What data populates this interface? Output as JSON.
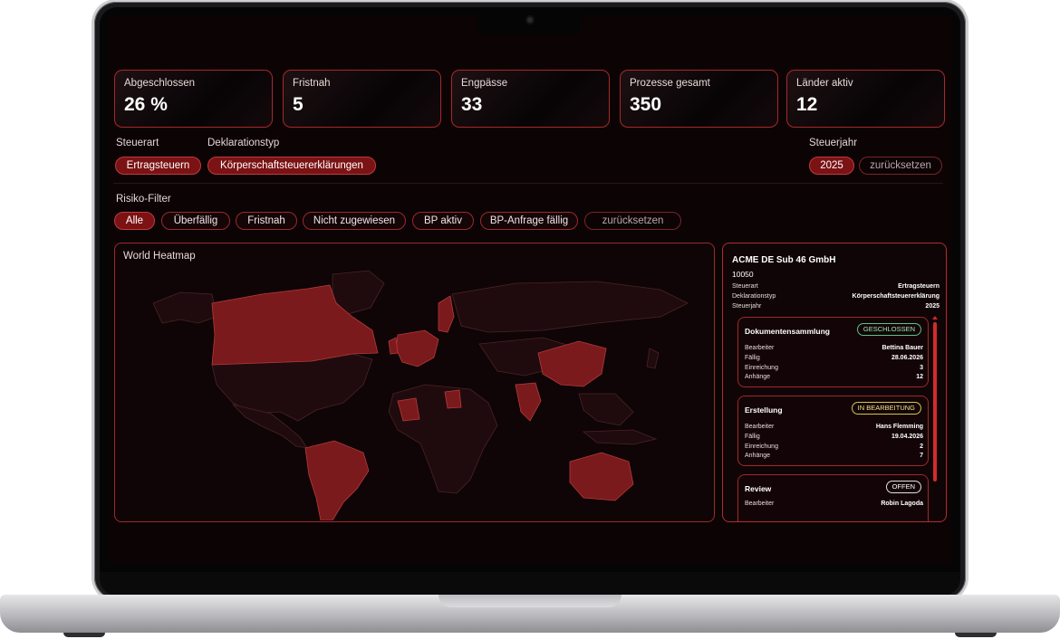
{
  "kpis": [
    {
      "label": "Abgeschlossen",
      "value": "26 %"
    },
    {
      "label": "Fristnah",
      "value": "5"
    },
    {
      "label": "Engpässe",
      "value": "33"
    },
    {
      "label": "Prozesse gesamt",
      "value": "350"
    },
    {
      "label": "Länder aktiv",
      "value": "12"
    }
  ],
  "filters": {
    "steuerart_label": "Steuerart",
    "steuerart_value": "Ertragsteuern",
    "deklarationstyp_label": "Deklarationstyp",
    "deklarationstyp_value": "Körperschaftsteuererklärungen",
    "steuerjahr_label": "Steuerjahr",
    "steuerjahr_value": "2025",
    "reset_label": "zurücksetzen"
  },
  "risk_filter": {
    "label": "Risiko-Filter",
    "options": [
      "Alle",
      "Überfällig",
      "Fristnah",
      "Nicht zugewiesen",
      "BP aktiv",
      "BP-Anfrage fällig"
    ],
    "active": "Alle",
    "reset_label": "zurücksetzen"
  },
  "map": {
    "title": "World Heatmap",
    "highlight_color": "#7a1a1c",
    "base_color": "#1a0a0c"
  },
  "detail": {
    "company": "ACME DE Sub 46 GmbH",
    "id": "10050",
    "fields": [
      {
        "key": "Steuerart",
        "value": "Ertragsteuern"
      },
      {
        "key": "Deklarationstyp",
        "value": "Körperschaftsteuererklärung"
      },
      {
        "key": "Steuerjahr",
        "value": "2025"
      }
    ],
    "steps": [
      {
        "name": "Dokumentensammlung",
        "status": "GESCHLOSSEN",
        "status_color": "green",
        "rows": [
          {
            "key": "Bearbeiter",
            "value": "Bettina Bauer"
          },
          {
            "key": "Fällig",
            "value": "28.06.2026"
          },
          {
            "key": "Einreichung",
            "value": "3"
          },
          {
            "key": "Anhänge",
            "value": "12"
          }
        ]
      },
      {
        "name": "Erstellung",
        "status": "IN BEARBEITUNG",
        "status_color": "yellow",
        "rows": [
          {
            "key": "Bearbeiter",
            "value": "Hans Flemming"
          },
          {
            "key": "Fällig",
            "value": "19.04.2026"
          },
          {
            "key": "Einreichung",
            "value": "2"
          },
          {
            "key": "Anhänge",
            "value": "7"
          }
        ]
      },
      {
        "name": "Review",
        "status": "OFFEN",
        "status_color": "white",
        "rows": [
          {
            "key": "Bearbeiter",
            "value": "Robin Lagoda"
          }
        ]
      }
    ]
  }
}
